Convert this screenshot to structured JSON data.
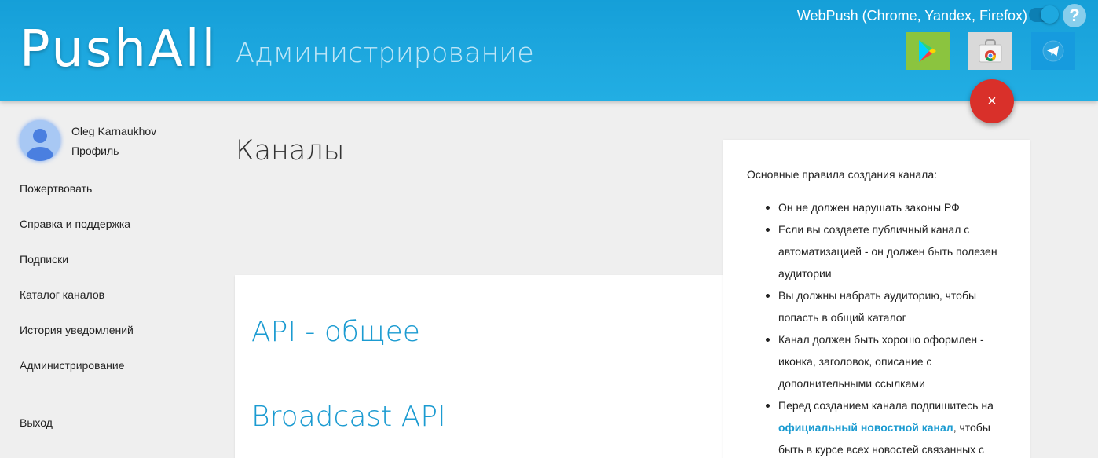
{
  "header": {
    "logo": "PushAll",
    "subtitle": "Администрирование",
    "webpush_label": "WebPush (Chrome, Yandex, Firefox)",
    "help_label": "?",
    "stores": [
      "google-play-icon",
      "chrome-webstore-icon",
      "telegram-icon"
    ]
  },
  "fab": {
    "label": "×"
  },
  "user": {
    "name": "Oleg Karnaukhov",
    "profile_label": "Профиль"
  },
  "sidebar": {
    "items": [
      {
        "label": "Пожертвовать"
      },
      {
        "label": "Справка и поддержка"
      },
      {
        "label": "Подписки"
      },
      {
        "label": "Каталог каналов"
      },
      {
        "label": "История уведомлений"
      },
      {
        "label": "Администрирование"
      }
    ],
    "logout_label": "Выход"
  },
  "main": {
    "title": "Каналы",
    "links": [
      {
        "label": "API - общее"
      },
      {
        "label": "Broadcast API"
      }
    ]
  },
  "rules": {
    "intro": "Основные правила создания канала:",
    "items": [
      {
        "text": "Он не должен нарушать законы РФ"
      },
      {
        "text": "Если вы создаете публичный канал с автоматизацией - он должен быть полезен аудитории"
      },
      {
        "text": "Вы должны набрать аудиторию, чтобы попасть в общий каталог"
      },
      {
        "text": "Канал должен быть хорошо оформлен - иконка, заголовок, описание с дополнительными ссылками"
      }
    ],
    "last_item": {
      "before": "Перед созданием канала подпишитесь на",
      "link": "официальный новостной канал",
      "after": ", чтобы быть в курсе всех новостей связанных с"
    }
  },
  "colors": {
    "header": "#1ea8df",
    "link": "#1b9bd1",
    "fab": "#d9302a",
    "play": "#8bc43f",
    "telegram": "#169bde"
  }
}
